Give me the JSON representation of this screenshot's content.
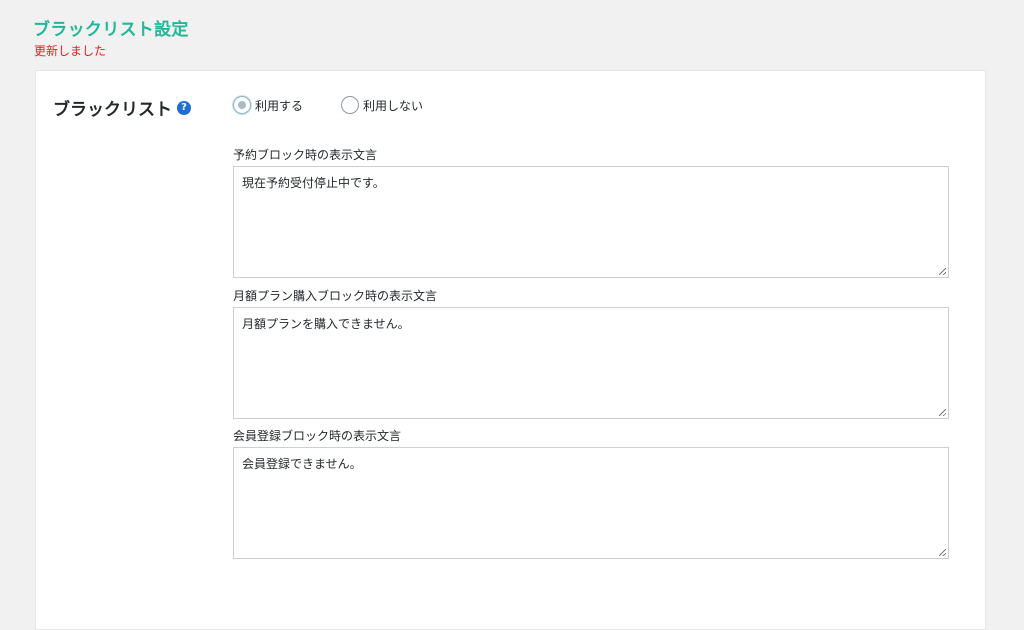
{
  "header": {
    "title": "ブラックリスト設定",
    "notice": "更新しました"
  },
  "blacklist": {
    "label": "ブラックリスト",
    "help_icon": "question-circle-icon",
    "options": [
      {
        "label": "利用する",
        "checked": true
      },
      {
        "label": "利用しない",
        "checked": false
      }
    ]
  },
  "fields": [
    {
      "label": "予約ブロック時の表示文言",
      "value": "現在予約受付停止中です。"
    },
    {
      "label": "月額プラン購入ブロック時の表示文言",
      "value": "月額プランを購入できません。"
    },
    {
      "label": "会員登録ブロック時の表示文言",
      "value": "会員登録できません。"
    }
  ],
  "colors": {
    "title": "#1fb89a",
    "notice": "#e02424",
    "help_icon": "#1e6fd0"
  }
}
